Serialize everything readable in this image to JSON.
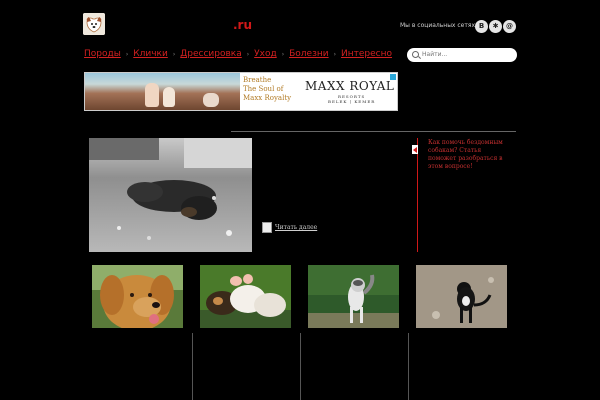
{
  "header": {
    "site_suffix": ".ru",
    "social_label": "Мы в социальных сетях:",
    "social": [
      {
        "name": "vk",
        "glyph": "B"
      },
      {
        "name": "odnoklassniki",
        "glyph": "✱"
      },
      {
        "name": "mailru",
        "glyph": "@"
      }
    ]
  },
  "nav": {
    "items": [
      "Породы",
      "Клички",
      "Дрессировка",
      "Уход",
      "Болезни",
      "Интересно"
    ]
  },
  "search": {
    "placeholder": "Найти..."
  },
  "ad": {
    "tagline_1": "Breathe",
    "tagline_2": "The Soul of",
    "tagline_3": "Maxx Royalty",
    "brand": "MAXX ROYAL",
    "sub_1": "RESORTS",
    "sub_2": "BELEK | KEMER"
  },
  "content": {
    "read_more": "Читать далее",
    "sidebar_text": "Как помочь бездомным собакам? Статья поможет разобраться в этом вопросе!"
  },
  "colors": {
    "accent": "#d01818",
    "background": "#000000",
    "text_light": "#cfcfcf"
  }
}
